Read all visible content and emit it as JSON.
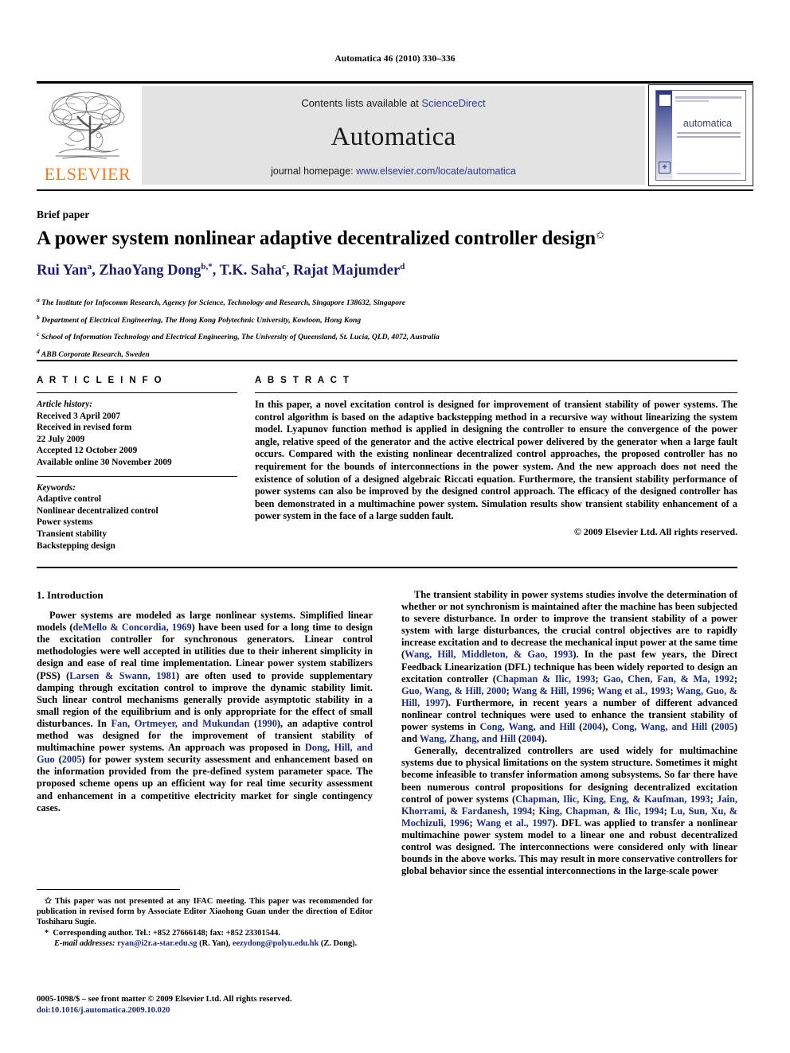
{
  "running_head": "Automatica 46 (2010) 330–336",
  "masthead": {
    "contents_prefix": "Contents lists available at ",
    "sciencedirect": "ScienceDirect",
    "journal_title": "Automatica",
    "homepage_prefix": "journal homepage: ",
    "homepage_url": "www.elsevier.com/locate/automatica",
    "publisher_wordmark": "ELSEVIER",
    "cover_title": "automatica",
    "colors": {
      "elsevier_orange": "#F07C1B",
      "link_blue": "#2b3a8f",
      "band_gray": "#e3e3e3"
    }
  },
  "article": {
    "type_label": "Brief paper",
    "title": "A power system nonlinear adaptive decentralized controller design",
    "title_footnote_marker": "✩",
    "authors": [
      {
        "name": "Rui Yan",
        "sup": "a"
      },
      {
        "name": "ZhaoYang Dong",
        "sup": "b,*"
      },
      {
        "name": "T.K. Saha",
        "sup": "c"
      },
      {
        "name": "Rajat Majumder",
        "sup": "d"
      }
    ],
    "affiliations": [
      {
        "marker": "a",
        "text": "The Institute for Infocomm Research, Agency for Science, Technology and Research, Singapore 138632, Singapore"
      },
      {
        "marker": "b",
        "text": "Department of Electrical Engineering, The Hong Kong Polytechnic University, Kowloon, Hong Kong"
      },
      {
        "marker": "c",
        "text": "School of Information Technology and Electrical Engineering, The University of Queensland, St. Lucia, QLD, 4072, Australia"
      },
      {
        "marker": "d",
        "text": "ABB Corporate Research, Sweden"
      }
    ],
    "author_color": "#1b1f6e"
  },
  "article_info": {
    "heading": "A R T I C L E    I N F O",
    "history_label": "Article history:",
    "history": [
      "Received 3 April 2007",
      "Received in revised form",
      "22 July 2009",
      "Accepted 12 October 2009",
      "Available online 30 November 2009"
    ],
    "keywords_label": "Keywords:",
    "keywords": [
      "Adaptive control",
      "Nonlinear decentralized control",
      "Power systems",
      "Transient stability",
      "Backstepping design"
    ]
  },
  "abstract": {
    "heading": "A B S T R A C T",
    "text": "In this paper, a novel excitation control is designed for improvement of transient stability of power systems. The control algorithm is based on the adaptive backstepping method in a recursive way without linearizing the system model. Lyapunov function method is applied in designing the controller to ensure the convergence of the power angle, relative speed of the generator and the active electrical power delivered by the generator when a large fault occurs. Compared with the existing nonlinear decentralized control approaches, the proposed controller has no requirement for the bounds of interconnections in the power system. And the new approach does not need the existence of solution of a designed algebraic Riccati equation. Furthermore, the transient stability performance of power systems can also be improved by the designed control approach. The efficacy of the designed controller has been demonstrated in a multimachine power system. Simulation results show transient stability enhancement of a power system in the face of a large sudden fault.",
    "copyright": "© 2009 Elsevier Ltd. All rights reserved."
  },
  "body": {
    "section_heading": "1. Introduction",
    "left_paragraphs": [
      "Power systems are modeled as large nonlinear systems. Simplified linear models (deMello & Concordia, 1969) have been used for a long time to design the excitation controller for synchronous generators. Linear control methodologies were well accepted in utilities due to their inherent simplicity in design and ease of real time implementation. Linear power system stabilizers (PSS) (Larsen & Swann, 1981) are often used to provide supplementary damping through excitation control to improve the dynamic stability limit. Such linear control mechanisms generally provide asymptotic stability in a small region of the equilibrium and is only appropriate for the effect of small disturbances. In Fan, Ortmeyer, and Mukundan (1990), an adaptive control method was designed for the improvement of transient stability of multimachine power systems. An approach was proposed in Dong, Hill, and Guo (2005) for power system security assessment and enhancement based on the information provided from the pre-defined system parameter space. The proposed scheme opens up an efficient way for real time security assessment and enhancement in a competitive electricity market for single contingency cases."
    ],
    "right_paragraphs": [
      "The transient stability in power systems studies involve the determination of whether or not synchronism is maintained after the machine has been subjected to severe disturbance. In order to improve the transient stability of a power system with large disturbances, the crucial control objectives are to rapidly increase excitation and to decrease the mechanical input power at the same time (Wang, Hill, Middleton, & Gao, 1993). In the past few years, the Direct Feedback Linearization (DFL) technique has been widely reported to design an excitation controller (Chapman & Ilic, 1993; Gao, Chen, Fan, & Ma, 1992; Guo, Wang, & Hill, 2000; Wang & Hill, 1996; Wang et al., 1993; Wang, Guo, & Hill, 1997). Furthermore, in recent years a number of different advanced nonlinear control techniques were used to enhance  the transient stability of power systems in Cong, Wang, and Hill (2004), Cong, Wang, and Hill (2005) and Wang, Zhang, and Hill (2004).",
      "Generally, decentralized controllers are used widely for multimachine systems due to physical limitations on the system structure. Sometimes it might become infeasible to transfer information among subsystems. So far there have been numerous control propositions for designing decentralized excitation control of power systems (Chapman, Ilic, King, Eng, & Kaufman, 1993; Jain, Khorrami, & Fardanesh, 1994; King, Chapman, & Ilic, 1994; Lu, Sun, Xu, & Mochizuli, 1996; Wang et al., 1997). DFL was applied to transfer a nonlinear multimachine power system model to a linear one and robust decentralized control was designed. The interconnections were considered only with linear bounds in the above works. This may result in more conservative controllers for global behavior since the essential interconnections in the large-scale power"
    ]
  },
  "footnotes": {
    "star_note": "This paper was not presented at any IFAC meeting. This paper was recommended for publication in revised form by Associate Editor Xiaohong Guan under the direction of Editor Toshiharu Sugie.",
    "corresponding": "Corresponding author. Tel.: +852 27666148; fax: +852 23301544.",
    "email_label": "E-mail addresses:",
    "email1": "ryan@i2r.a-star.edu.sg",
    "email1_who": "(R. Yan),",
    "email2": "eezydong@polyu.edu.hk",
    "email2_who": "(Z. Dong).",
    "issn_line": "0005-1098/$ – see front matter © 2009 Elsevier Ltd. All rights reserved.",
    "doi_line": "doi:10.1016/j.automatica.2009.10.020"
  }
}
